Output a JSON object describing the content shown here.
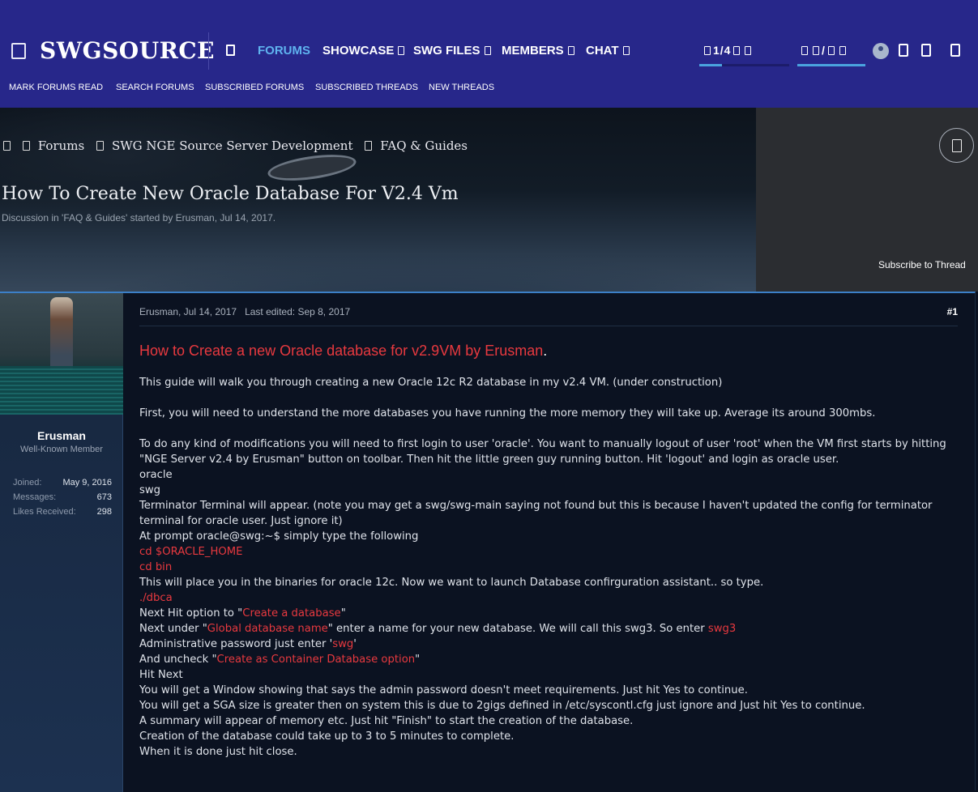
{
  "header": {
    "brand": "SWGSOURCE",
    "nav": [
      {
        "label": "FORUMS",
        "active": true
      },
      {
        "label": "SHOWCASE",
        "dropdown": true
      },
      {
        "label": "SWG FILES",
        "dropdown": true
      },
      {
        "label": "MEMBERS",
        "dropdown": true
      },
      {
        "label": "CHAT",
        "dropdown": true
      }
    ],
    "inbox_count": "1/4",
    "alerts_count": "/",
    "accent": "#5fb3ef",
    "bg": "#27278a"
  },
  "subnav": [
    "MARK FORUMS READ",
    "SEARCH FORUMS",
    "SUBSCRIBED FORUMS",
    "SUBSCRIBED THREADS",
    "NEW THREADS"
  ],
  "breadcrumbs": [
    "Forums",
    "SWG NGE Source Server Development",
    "FAQ & Guides"
  ],
  "thread": {
    "title": "How To Create New Oracle Database For V2.4 Vm",
    "subtitle": "Discussion in 'FAQ & Guides' started by Erusman, Jul 14, 2017.",
    "subscribe": "Subscribe to Thread"
  },
  "user": {
    "name": "Erusman",
    "title": "Well-Known Member",
    "stats": [
      {
        "key": "Joined:",
        "value": "May 9, 2016"
      },
      {
        "key": "Messages:",
        "value": "673"
      },
      {
        "key": "Likes Received:",
        "value": "298"
      }
    ]
  },
  "post": {
    "meta": "Erusman, Jul 14, 2017   Last edited: Sep 8, 2017",
    "number": "#1",
    "heading": "How to Create a new Oracle database for v2.9VM by Erusman",
    "heading_end": ".",
    "p1": "This guide will walk you through creating a new Oracle 12c R2 database in my v2.4 VM. (under construction)",
    "p2": "First, you will need to understand the more databases you have running the more memory they will take up. Average its around 300mbs.",
    "p3": "To do any kind of modifications you will need to first login to user 'oracle'. You want to manually logout of user 'root' when the VM first starts by hitting \"NGE Server v2.4 by Erusman\" button on toolbar. Then hit the little green guy running button. Hit 'logout' and login as oracle user.",
    "l_oracle": "oracle",
    "l_swg": "swg",
    "l_terminator": "Terminator Terminal will appear. (note you may get a swg/swg-main saying not found but this is because I haven't updated the config for terminator terminal for oracle user. Just ignore it)",
    "l_prompt": "At prompt oracle@swg:~$ simply type the following",
    "l_cd_home": "cd $ORACLE_HOME",
    "l_cd_bin": "cd bin",
    "l_place": "This will place you in the binaries for oracle 12c. Now we want to launch Database confirguration assistant.. so type.",
    "l_dbca": "./dbca",
    "l_next_hit_a": "Next Hit option to \"",
    "l_next_hit_red": "Create a database",
    "l_next_hit_b": "\"",
    "l_next_under_a": "Next under \"",
    "l_next_under_red": "Global database name",
    "l_next_under_b": "\" enter a name for your new database. We will call this swg3. So enter ",
    "l_next_under_red2": "swg3",
    "l_admin_a": "Administrative password just enter '",
    "l_admin_red": "swg",
    "l_admin_b": "'",
    "l_uncheck_a": "And uncheck \"",
    "l_uncheck_red": "Create as Container Database option",
    "l_uncheck_b": "\"",
    "l_hit_next": "Hit Next",
    "l_window": "You will get a Window showing that says the admin password doesn't meet requirements. Just hit Yes to continue.",
    "l_sga": "You will get a SGA size is greater then on system this is due to 2gigs defined in /etc/syscontl.cfg just ignore and Just hit Yes to continue.",
    "l_summary": "A summary will appear of memory etc. Just hit \"Finish\" to start the creation of the database.",
    "l_creation": "Creation of the database could take up to 3 to 5 minutes to complete.",
    "l_done": "When it is done just hit close.",
    "link_color": "#e8393f"
  }
}
